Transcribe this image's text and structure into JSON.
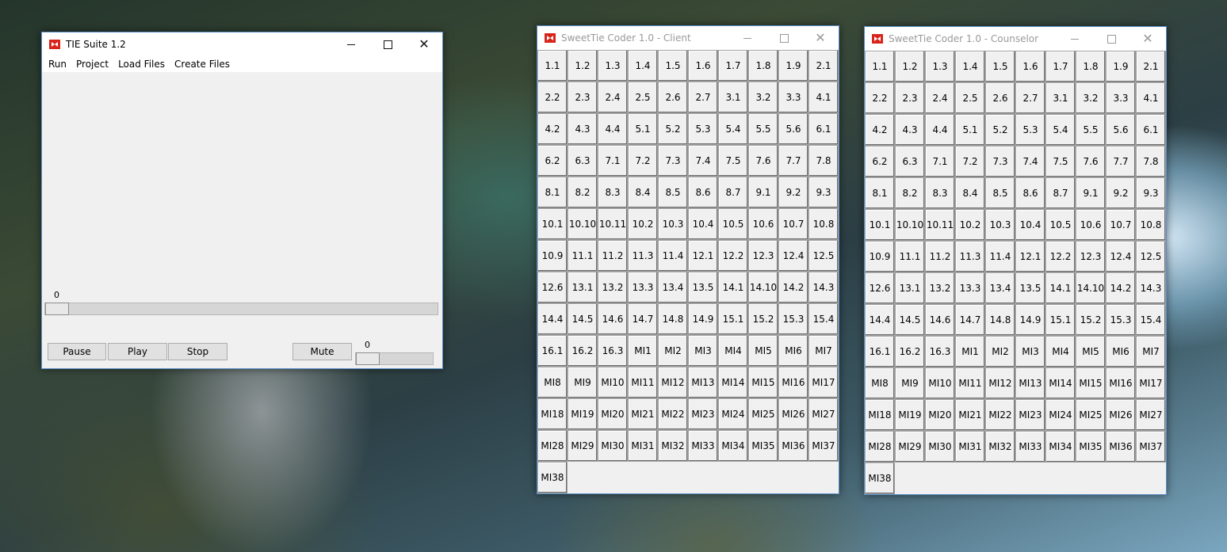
{
  "tie": {
    "title": "TIE Suite 1.2",
    "menu": [
      "Run",
      "Project",
      "Load Files",
      "Create Files"
    ],
    "progress_value": "0",
    "volume_value": "0",
    "buttons": {
      "pause": "Pause",
      "play": "Play",
      "stop": "Stop",
      "mute": "Mute"
    }
  },
  "client": {
    "title": "SweetTie Coder 1.0 - Client",
    "codes": [
      "1.1",
      "1.2",
      "1.3",
      "1.4",
      "1.5",
      "1.6",
      "1.7",
      "1.8",
      "1.9",
      "2.1",
      "2.2",
      "2.3",
      "2.4",
      "2.5",
      "2.6",
      "2.7",
      "3.1",
      "3.2",
      "3.3",
      "4.1",
      "4.2",
      "4.3",
      "4.4",
      "5.1",
      "5.2",
      "5.3",
      "5.4",
      "5.5",
      "5.6",
      "6.1",
      "6.2",
      "6.3",
      "7.1",
      "7.2",
      "7.3",
      "7.4",
      "7.5",
      "7.6",
      "7.7",
      "7.8",
      "8.1",
      "8.2",
      "8.3",
      "8.4",
      "8.5",
      "8.6",
      "8.7",
      "9.1",
      "9.2",
      "9.3",
      "10.1",
      "10.10",
      "10.11",
      "10.2",
      "10.3",
      "10.4",
      "10.5",
      "10.6",
      "10.7",
      "10.8",
      "10.9",
      "11.1",
      "11.2",
      "11.3",
      "11.4",
      "12.1",
      "12.2",
      "12.3",
      "12.4",
      "12.5",
      "12.6",
      "13.1",
      "13.2",
      "13.3",
      "13.4",
      "13.5",
      "14.1",
      "14.10",
      "14.2",
      "14.3",
      "14.4",
      "14.5",
      "14.6",
      "14.7",
      "14.8",
      "14.9",
      "15.1",
      "15.2",
      "15.3",
      "15.4",
      "16.1",
      "16.2",
      "16.3",
      "MI1",
      "MI2",
      "MI3",
      "MI4",
      "MI5",
      "MI6",
      "MI7",
      "MI8",
      "MI9",
      "MI10",
      "MI11",
      "MI12",
      "MI13",
      "MI14",
      "MI15",
      "MI16",
      "MI17",
      "MI18",
      "MI19",
      "MI20",
      "MI21",
      "MI22",
      "MI23",
      "MI24",
      "MI25",
      "MI26",
      "MI27",
      "MI28",
      "MI29",
      "MI30",
      "MI31",
      "MI32",
      "MI33",
      "MI34",
      "MI35",
      "MI36",
      "MI37",
      "MI38"
    ]
  },
  "counselor": {
    "title": "SweetTie Coder 1.0 - Counselor",
    "codes": [
      "1.1",
      "1.2",
      "1.3",
      "1.4",
      "1.5",
      "1.6",
      "1.7",
      "1.8",
      "1.9",
      "2.1",
      "2.2",
      "2.3",
      "2.4",
      "2.5",
      "2.6",
      "2.7",
      "3.1",
      "3.2",
      "3.3",
      "4.1",
      "4.2",
      "4.3",
      "4.4",
      "5.1",
      "5.2",
      "5.3",
      "5.4",
      "5.5",
      "5.6",
      "6.1",
      "6.2",
      "6.3",
      "7.1",
      "7.2",
      "7.3",
      "7.4",
      "7.5",
      "7.6",
      "7.7",
      "7.8",
      "8.1",
      "8.2",
      "8.3",
      "8.4",
      "8.5",
      "8.6",
      "8.7",
      "9.1",
      "9.2",
      "9.3",
      "10.1",
      "10.10",
      "10.11",
      "10.2",
      "10.3",
      "10.4",
      "10.5",
      "10.6",
      "10.7",
      "10.8",
      "10.9",
      "11.1",
      "11.2",
      "11.3",
      "11.4",
      "12.1",
      "12.2",
      "12.3",
      "12.4",
      "12.5",
      "12.6",
      "13.1",
      "13.2",
      "13.3",
      "13.4",
      "13.5",
      "14.1",
      "14.10",
      "14.2",
      "14.3",
      "14.4",
      "14.5",
      "14.6",
      "14.7",
      "14.8",
      "14.9",
      "15.1",
      "15.2",
      "15.3",
      "15.4",
      "16.1",
      "16.2",
      "16.3",
      "MI1",
      "MI2",
      "MI3",
      "MI4",
      "MI5",
      "MI6",
      "MI7",
      "MI8",
      "MI9",
      "MI10",
      "MI11",
      "MI12",
      "MI13",
      "MI14",
      "MI15",
      "MI16",
      "MI17",
      "MI18",
      "MI19",
      "MI20",
      "MI21",
      "MI22",
      "MI23",
      "MI24",
      "MI25",
      "MI26",
      "MI27",
      "MI28",
      "MI29",
      "MI30",
      "MI31",
      "MI32",
      "MI33",
      "MI34",
      "MI35",
      "MI36",
      "MI37",
      "MI38"
    ]
  }
}
